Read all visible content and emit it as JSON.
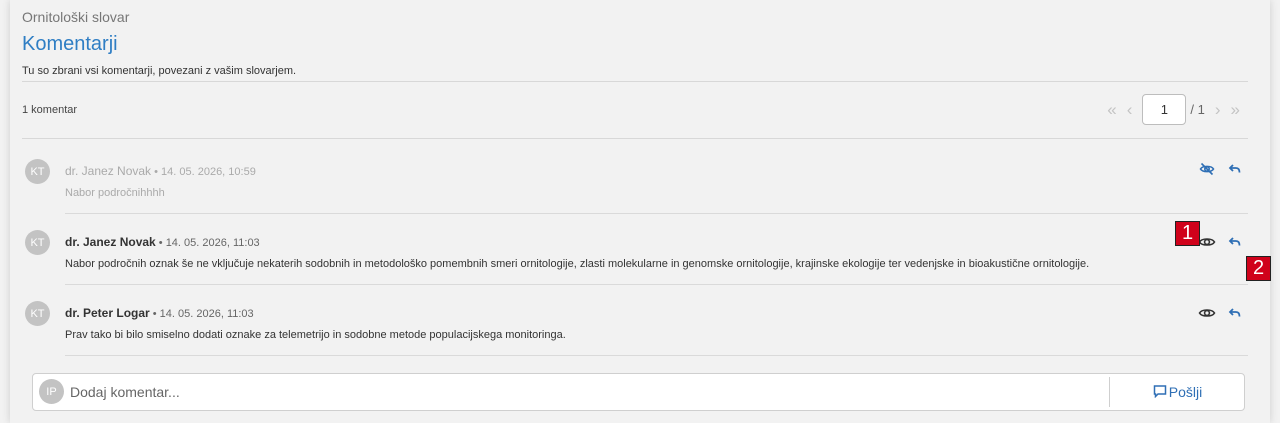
{
  "header": {
    "dictionary_name": "Ornitološki slovar",
    "title": "Komentarji",
    "subtitle": "Tu so zbrani vsi komentarji, povezani z vašim slovarjem."
  },
  "list": {
    "count_label": "1 komentar",
    "pagination": {
      "first_icon": "double-chevron-left-icon",
      "prev_icon": "chevron-left-icon",
      "current_page": "1",
      "total_label": "/ 1",
      "next_icon": "chevron-right-icon",
      "last_icon": "double-chevron-right-icon"
    }
  },
  "comments": [
    {
      "initials": "KT",
      "author": "dr. Janez Novak",
      "timestamp": "• 14. 05. 2026, 10:59",
      "text": "Nabor področnihhhh",
      "hidden": true,
      "visibility_icon": "eye-slash-icon",
      "reply_icon": "reply-icon"
    },
    {
      "initials": "KT",
      "author": "dr. Janez Novak",
      "timestamp": "• 14. 05. 2026, 11:03",
      "text": "Nabor področnih oznak še ne vključuje nekaterih sodobnih in metodološko pomembnih smeri ornitologije, zlasti molekularne in genomske ornitologije, krajinske ekologije ter vedenjske in bioakustične ornitologije.",
      "hidden": false,
      "visibility_icon": "eye-icon",
      "reply_icon": "reply-icon"
    },
    {
      "initials": "KT",
      "author": "dr. Peter Logar",
      "timestamp": "• 14. 05. 2026, 11:03",
      "text": "Prav tako bi bilo smiselno dodati oznake za telemetrijo in sodobne metode populacijskega monitoringa.",
      "hidden": false,
      "visibility_icon": "eye-icon",
      "reply_icon": "reply-icon"
    }
  ],
  "annotations": {
    "badge_1": "1",
    "badge_2": "2"
  },
  "composer": {
    "initials": "IP",
    "placeholder": "Dodaj komentar...",
    "send_label": "Pošlji",
    "send_icon": "comment-icon"
  },
  "colors": {
    "accent": "#2f7ec4",
    "badge": "#d0021b",
    "muted": "#aaaaaa"
  }
}
